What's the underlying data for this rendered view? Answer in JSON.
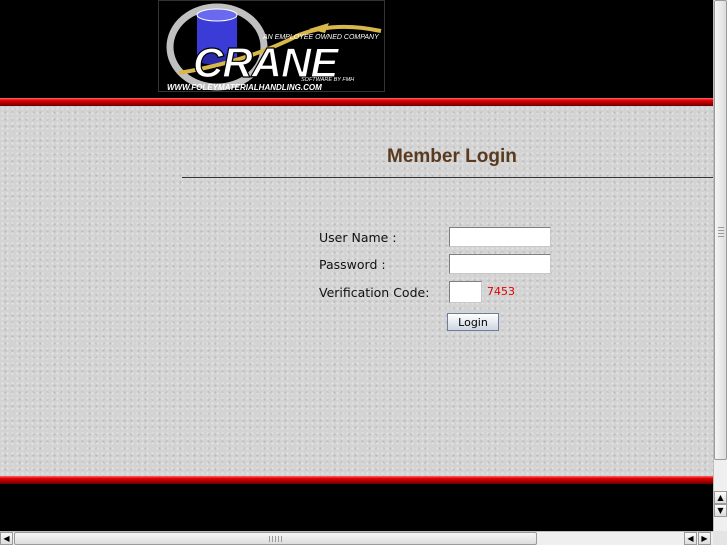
{
  "logo": {
    "brand": "CRANE",
    "tagline": "AN EMPLOYEE OWNED COMPANY",
    "sub": "SOFTWARE BY FMH",
    "url": "WWW.FOLEYMATERIALHANDLING.COM"
  },
  "login": {
    "title": "Member Login",
    "username_label": "User Name :",
    "password_label": "Password :",
    "code_label": "Verification Code:",
    "captcha": "7453",
    "username_value": "",
    "password_value": "",
    "code_value": "",
    "button": "Login"
  },
  "colors": {
    "title": "#5a3a1e",
    "captcha": "#e00000",
    "band": "#e30000",
    "background": "#000000"
  }
}
